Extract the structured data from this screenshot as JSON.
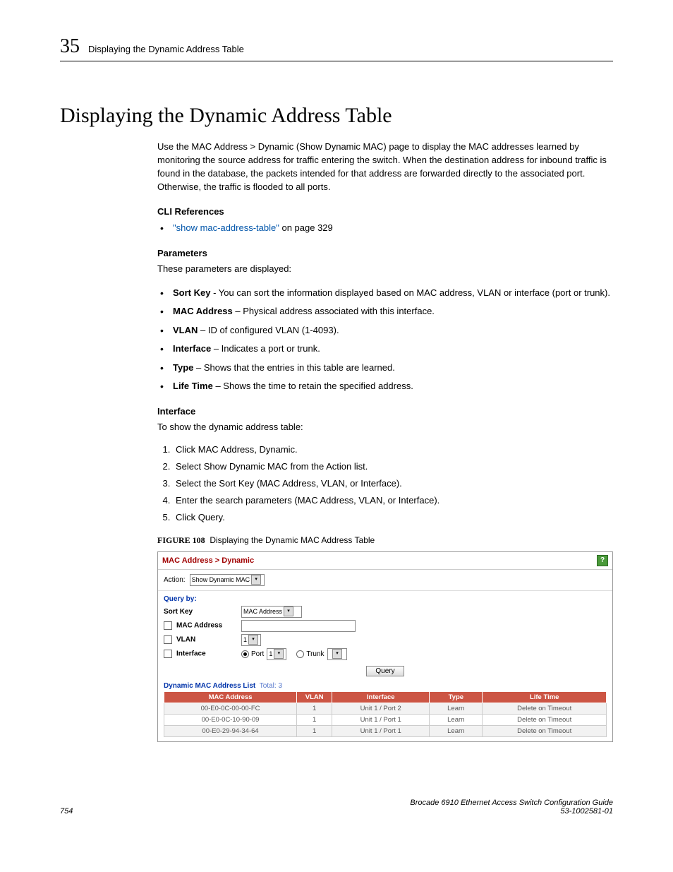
{
  "header": {
    "num": "35",
    "text": "Displaying the Dynamic Address Table"
  },
  "h1": "Displaying the Dynamic Address Table",
  "intro": "Use the MAC Address > Dynamic (Show Dynamic MAC) page to display the MAC addresses learned by monitoring the source address for traffic entering the switch. When the destination address for inbound traffic is found in the database, the packets intended for that address are forwarded directly to the associated port. Otherwise, the traffic is flooded to all ports.",
  "cliHead": "CLI References",
  "cliLink": "\"show mac-address-table\"",
  "cliAfter": " on page 329",
  "paramHead": "Parameters",
  "paramIntro": "These parameters are displayed:",
  "params": [
    {
      "b": "Sort Key",
      "t": " - You can sort the information displayed based on MAC address, VLAN or interface (port or trunk)."
    },
    {
      "b": "MAC Address",
      "t": " – Physical address associated with this interface."
    },
    {
      "b": "VLAN",
      "t": " – ID of configured VLAN (1-4093)."
    },
    {
      "b": "Interface",
      "t": " – Indicates a port or trunk."
    },
    {
      "b": "Type",
      "t": " – Shows that the entries in this table are learned."
    },
    {
      "b": "Life Time",
      "t": " – Shows the time to retain the specified address."
    }
  ],
  "ifHead": "Interface",
  "ifIntro": "To show the dynamic address table:",
  "steps": [
    "Click MAC Address, Dynamic.",
    "Select Show Dynamic MAC from the Action list.",
    "Select the Sort Key (MAC Address, VLAN, or Interface).",
    "Enter the search parameters (MAC Address, VLAN, or Interface).",
    "Click Query."
  ],
  "figLabel": "FIGURE 108",
  "figTitle": "Displaying the Dynamic MAC Address Table",
  "shot": {
    "breadcrumb": "MAC Address > Dynamic",
    "help": "?",
    "actionLabel": "Action:",
    "actionValue": "Show Dynamic MAC",
    "queryBy": "Query by:",
    "sortKey": "Sort Key",
    "sortVal": "MAC Address",
    "macLabel": "MAC Address",
    "vlanLabel": "VLAN",
    "vlanVal": "1",
    "ifaceLabel": "Interface",
    "portLabel": "Port",
    "portVal": "1",
    "trunkLabel": "Trunk",
    "queryBtn": "Query",
    "listTitle": "Dynamic MAC Address List",
    "totalLabel": "Total:",
    "totalVal": "3",
    "cols": {
      "c1": "MAC Address",
      "c2": "VLAN",
      "c3": "Interface",
      "c4": "Type",
      "c5": "Life Time"
    },
    "rows": [
      {
        "c1": "00-E0-0C-00-00-FC",
        "c2": "1",
        "c3": "Unit 1 / Port 2",
        "c4": "Learn",
        "c5": "Delete on Timeout"
      },
      {
        "c1": "00-E0-0C-10-90-09",
        "c2": "1",
        "c3": "Unit 1 / Port 1",
        "c4": "Learn",
        "c5": "Delete on Timeout"
      },
      {
        "c1": "00-E0-29-94-34-64",
        "c2": "1",
        "c3": "Unit 1 / Port 1",
        "c4": "Learn",
        "c5": "Delete on Timeout"
      }
    ]
  },
  "footer": {
    "page": "754",
    "title": "Brocade 6910 Ethernet Access Switch Configuration Guide",
    "docnum": "53-1002581-01"
  }
}
